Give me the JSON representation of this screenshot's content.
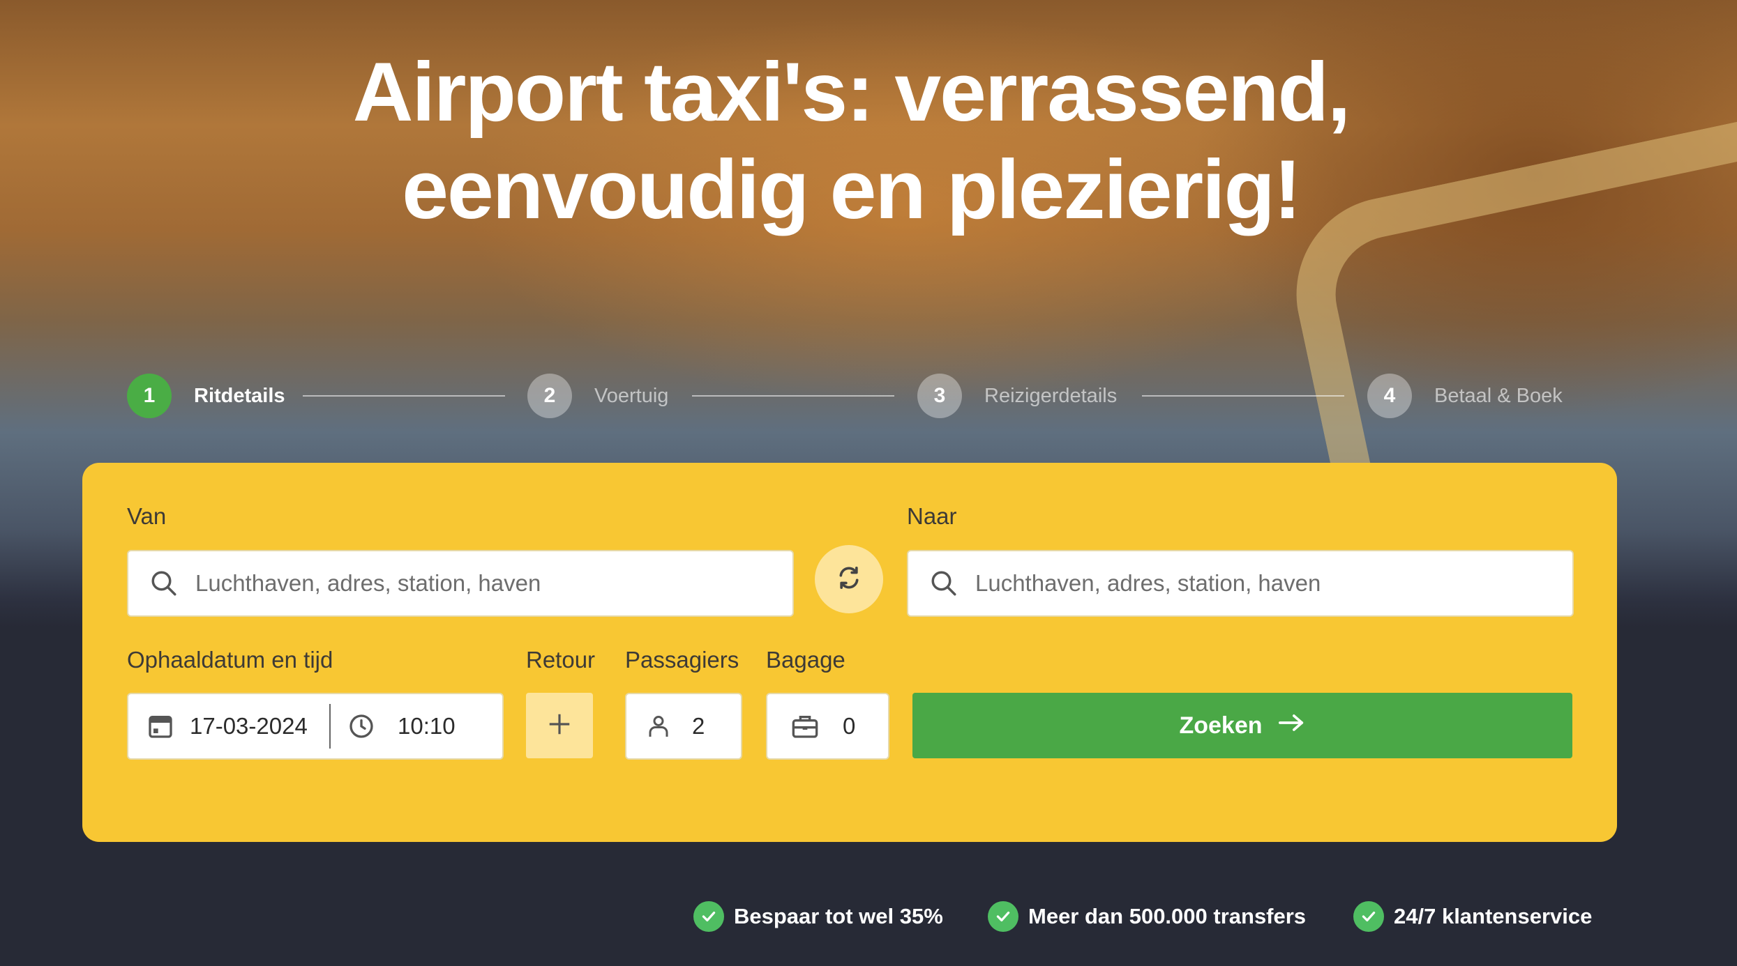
{
  "hero": {
    "headline_line1": "Airport taxi's: verrassend,",
    "headline_line2": "eenvoudig en plezierig!"
  },
  "stepper": {
    "steps": [
      {
        "number": "1",
        "label": "Ritdetails",
        "active": true
      },
      {
        "number": "2",
        "label": "Voertuig",
        "active": false
      },
      {
        "number": "3",
        "label": "Reizigerdetails",
        "active": false
      },
      {
        "number": "4",
        "label": "Betaal & Boek",
        "active": false
      }
    ]
  },
  "form": {
    "from": {
      "label": "Van",
      "placeholder": "Luchthaven, adres, station, haven",
      "value": ""
    },
    "to": {
      "label": "Naar",
      "placeholder": "Luchthaven, adres, station, haven",
      "value": ""
    },
    "pickup": {
      "label": "Ophaaldatum en tijd",
      "date": "17-03-2024",
      "time": "10:10"
    },
    "retour": {
      "label": "Retour"
    },
    "passengers": {
      "label": "Passagiers",
      "value": "2"
    },
    "luggage": {
      "label": "Bagage",
      "value": "0"
    },
    "search_button": "Zoeken"
  },
  "usps": [
    "Bespaar tot wel 35%",
    "Meer dan 500.000 transfers",
    "24/7 klantenservice"
  ],
  "colors": {
    "panel": "#f8c733",
    "accent_green": "#4aa846",
    "swap_bg": "#fde49a",
    "bottom_bg": "#272a36"
  },
  "icons": {
    "search": "search-icon",
    "swap": "swap-icon",
    "calendar": "calendar-icon",
    "clock": "clock-icon",
    "plus": "plus-icon",
    "person": "person-icon",
    "luggage": "briefcase-icon",
    "arrow": "arrow-right-icon",
    "check": "check-icon"
  }
}
